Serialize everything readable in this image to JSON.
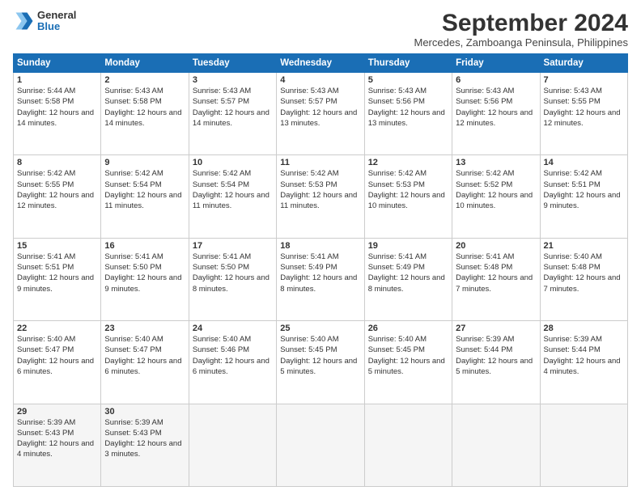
{
  "header": {
    "logo_general": "General",
    "logo_blue": "Blue",
    "month_title": "September 2024",
    "location": "Mercedes, Zamboanga Peninsula, Philippines"
  },
  "days_of_week": [
    "Sunday",
    "Monday",
    "Tuesday",
    "Wednesday",
    "Thursday",
    "Friday",
    "Saturday"
  ],
  "weeks": [
    [
      {
        "day": "1",
        "sunrise": "5:44 AM",
        "sunset": "5:58 PM",
        "daylight": "12 hours and 14 minutes."
      },
      {
        "day": "2",
        "sunrise": "5:43 AM",
        "sunset": "5:58 PM",
        "daylight": "12 hours and 14 minutes."
      },
      {
        "day": "3",
        "sunrise": "5:43 AM",
        "sunset": "5:57 PM",
        "daylight": "12 hours and 14 minutes."
      },
      {
        "day": "4",
        "sunrise": "5:43 AM",
        "sunset": "5:57 PM",
        "daylight": "12 hours and 13 minutes."
      },
      {
        "day": "5",
        "sunrise": "5:43 AM",
        "sunset": "5:56 PM",
        "daylight": "12 hours and 13 minutes."
      },
      {
        "day": "6",
        "sunrise": "5:43 AM",
        "sunset": "5:56 PM",
        "daylight": "12 hours and 12 minutes."
      },
      {
        "day": "7",
        "sunrise": "5:43 AM",
        "sunset": "5:55 PM",
        "daylight": "12 hours and 12 minutes."
      }
    ],
    [
      {
        "day": "8",
        "sunrise": "5:42 AM",
        "sunset": "5:55 PM",
        "daylight": "12 hours and 12 minutes."
      },
      {
        "day": "9",
        "sunrise": "5:42 AM",
        "sunset": "5:54 PM",
        "daylight": "12 hours and 11 minutes."
      },
      {
        "day": "10",
        "sunrise": "5:42 AM",
        "sunset": "5:54 PM",
        "daylight": "12 hours and 11 minutes."
      },
      {
        "day": "11",
        "sunrise": "5:42 AM",
        "sunset": "5:53 PM",
        "daylight": "12 hours and 11 minutes."
      },
      {
        "day": "12",
        "sunrise": "5:42 AM",
        "sunset": "5:53 PM",
        "daylight": "12 hours and 10 minutes."
      },
      {
        "day": "13",
        "sunrise": "5:42 AM",
        "sunset": "5:52 PM",
        "daylight": "12 hours and 10 minutes."
      },
      {
        "day": "14",
        "sunrise": "5:42 AM",
        "sunset": "5:51 PM",
        "daylight": "12 hours and 9 minutes."
      }
    ],
    [
      {
        "day": "15",
        "sunrise": "5:41 AM",
        "sunset": "5:51 PM",
        "daylight": "12 hours and 9 minutes."
      },
      {
        "day": "16",
        "sunrise": "5:41 AM",
        "sunset": "5:50 PM",
        "daylight": "12 hours and 9 minutes."
      },
      {
        "day": "17",
        "sunrise": "5:41 AM",
        "sunset": "5:50 PM",
        "daylight": "12 hours and 8 minutes."
      },
      {
        "day": "18",
        "sunrise": "5:41 AM",
        "sunset": "5:49 PM",
        "daylight": "12 hours and 8 minutes."
      },
      {
        "day": "19",
        "sunrise": "5:41 AM",
        "sunset": "5:49 PM",
        "daylight": "12 hours and 8 minutes."
      },
      {
        "day": "20",
        "sunrise": "5:41 AM",
        "sunset": "5:48 PM",
        "daylight": "12 hours and 7 minutes."
      },
      {
        "day": "21",
        "sunrise": "5:40 AM",
        "sunset": "5:48 PM",
        "daylight": "12 hours and 7 minutes."
      }
    ],
    [
      {
        "day": "22",
        "sunrise": "5:40 AM",
        "sunset": "5:47 PM",
        "daylight": "12 hours and 6 minutes."
      },
      {
        "day": "23",
        "sunrise": "5:40 AM",
        "sunset": "5:47 PM",
        "daylight": "12 hours and 6 minutes."
      },
      {
        "day": "24",
        "sunrise": "5:40 AM",
        "sunset": "5:46 PM",
        "daylight": "12 hours and 6 minutes."
      },
      {
        "day": "25",
        "sunrise": "5:40 AM",
        "sunset": "5:45 PM",
        "daylight": "12 hours and 5 minutes."
      },
      {
        "day": "26",
        "sunrise": "5:40 AM",
        "sunset": "5:45 PM",
        "daylight": "12 hours and 5 minutes."
      },
      {
        "day": "27",
        "sunrise": "5:39 AM",
        "sunset": "5:44 PM",
        "daylight": "12 hours and 5 minutes."
      },
      {
        "day": "28",
        "sunrise": "5:39 AM",
        "sunset": "5:44 PM",
        "daylight": "12 hours and 4 minutes."
      }
    ],
    [
      {
        "day": "29",
        "sunrise": "5:39 AM",
        "sunset": "5:43 PM",
        "daylight": "12 hours and 4 minutes."
      },
      {
        "day": "30",
        "sunrise": "5:39 AM",
        "sunset": "5:43 PM",
        "daylight": "12 hours and 3 minutes."
      },
      null,
      null,
      null,
      null,
      null
    ]
  ]
}
